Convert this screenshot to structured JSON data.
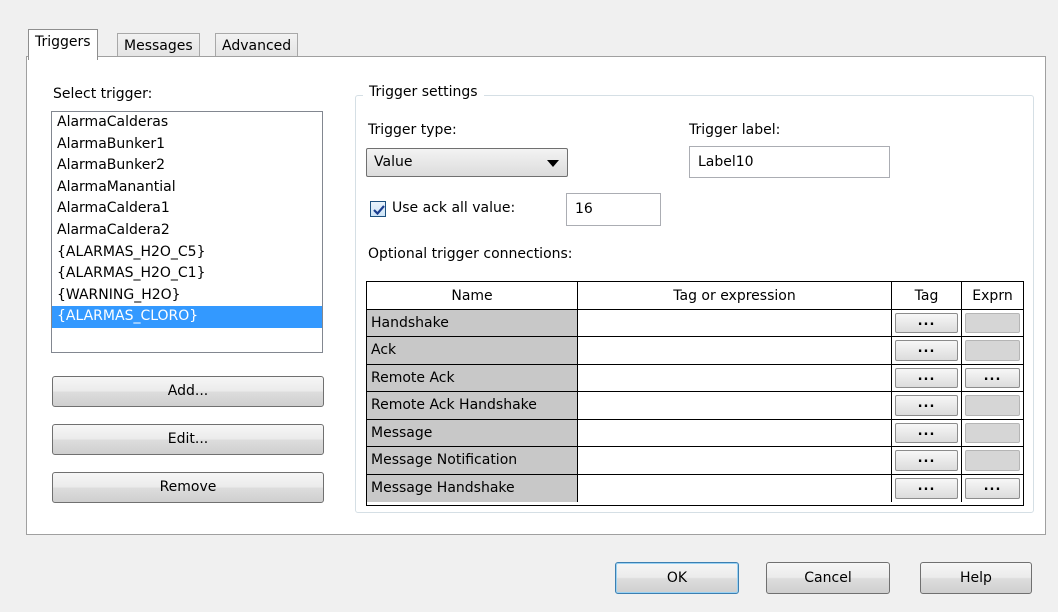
{
  "tabs": [
    {
      "label": "Triggers",
      "active": true
    },
    {
      "label": "Messages",
      "active": false
    },
    {
      "label": "Advanced",
      "active": false
    }
  ],
  "select_trigger": {
    "label": "Select trigger:",
    "items": [
      "AlarmaCalderas",
      "AlarmaBunker1",
      "AlarmaBunker2",
      "AlarmaManantial",
      "AlarmaCaldera1",
      "AlarmaCaldera2",
      "{ALARMAS_H2O_C5}",
      "{ALARMAS_H2O_C1}",
      "{WARNING_H2O}",
      "{ALARMAS_CLORO}"
    ],
    "selected_item": "{ALARMAS_CLORO}"
  },
  "left_buttons": {
    "add": "Add...",
    "edit": "Edit...",
    "remove": "Remove"
  },
  "trigger_settings": {
    "title": "Trigger settings",
    "trigger_type_label": "Trigger type:",
    "trigger_type_value": "Value",
    "trigger_label_label": "Trigger label:",
    "trigger_label_value": "Label10",
    "use_ack_all_label": "Use ack all value:",
    "use_ack_all_checked": true,
    "use_ack_all_value": "16",
    "optional_connections_label": "Optional trigger connections:"
  },
  "connections_table": {
    "columns": [
      "Name",
      "Tag or expression",
      "Tag",
      "Exprn"
    ],
    "ellipsis": "...",
    "rows": [
      {
        "name": "Handshake",
        "expression": "",
        "tag_btn": true,
        "exprn_btn": false
      },
      {
        "name": "Ack",
        "expression": "",
        "tag_btn": true,
        "exprn_btn": false
      },
      {
        "name": "Remote Ack",
        "expression": "",
        "tag_btn": true,
        "exprn_btn": true
      },
      {
        "name": "Remote Ack Handshake",
        "expression": "",
        "tag_btn": true,
        "exprn_btn": false
      },
      {
        "name": "Message",
        "expression": "",
        "tag_btn": true,
        "exprn_btn": false
      },
      {
        "name": "Message Notification",
        "expression": "",
        "tag_btn": true,
        "exprn_btn": false
      },
      {
        "name": "Message Handshake",
        "expression": "",
        "tag_btn": true,
        "exprn_btn": true
      }
    ]
  },
  "dialog_buttons": {
    "ok": "OK",
    "cancel": "Cancel",
    "help": "Help"
  }
}
